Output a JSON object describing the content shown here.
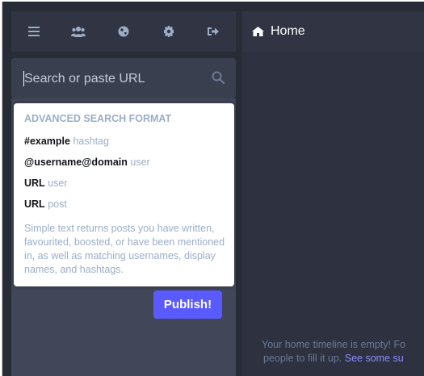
{
  "nav": {
    "items": [
      {
        "icon": "hamburger-icon",
        "label": "Menu"
      },
      {
        "icon": "users-icon",
        "label": "Local timeline"
      },
      {
        "icon": "globe-icon",
        "label": "Federated timeline"
      },
      {
        "icon": "gear-icon",
        "label": "Preferences"
      },
      {
        "icon": "sign-out-icon",
        "label": "Log out"
      }
    ]
  },
  "search": {
    "placeholder": "Search or paste URL",
    "value": ""
  },
  "search_popover": {
    "title": "Advanced search format",
    "rows": [
      {
        "key": "#example",
        "hint": "hashtag"
      },
      {
        "key": "@username@domain",
        "hint": "user"
      },
      {
        "key": "URL",
        "hint": "user"
      },
      {
        "key": "URL",
        "hint": "post"
      }
    ],
    "description_lines": [
      "Simple text returns posts you have written,",
      "favourited, boosted, or have been mentioned",
      "in, as well as matching usernames, display",
      "names, and hashtags."
    ]
  },
  "compose": {
    "publish_label": "Publish!"
  },
  "home": {
    "title": "Home",
    "empty_line1": "Your home timeline is empty! Fo",
    "empty_line2_prefix": "people to fill it up. ",
    "empty_link": "See some su"
  },
  "colors": {
    "background": "#282c37",
    "nav_bar": "#313543",
    "search_bg": "#393f4f",
    "compose_bg": "#414758",
    "accent": "#595aff",
    "muted": "#9baec8",
    "link": "#8c8dff"
  }
}
